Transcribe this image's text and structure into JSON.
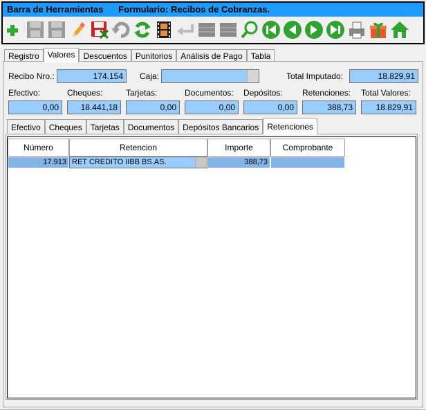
{
  "window": {
    "caption_left": "Barra de Herramientas",
    "caption_right": "Formulario: Recibos de Cobranzas."
  },
  "toolbar": {
    "buttons": [
      {
        "name": "add-icon",
        "color": "#33aa33"
      },
      {
        "name": "save-icon",
        "color": "#909090"
      },
      {
        "name": "save-as-icon",
        "color": "#909090"
      },
      {
        "name": "edit-pencil-icon",
        "color": "#e07020"
      },
      {
        "name": "cancel-save-icon",
        "color": "#cc2222"
      },
      {
        "name": "undo-icon",
        "color": "#909090"
      },
      {
        "name": "refresh-icon",
        "color": "#33aa33"
      },
      {
        "name": "film-icon",
        "color": "#b06010"
      },
      {
        "name": "back-arrow-icon",
        "color": "#c0c0c0"
      },
      {
        "name": "grid-icon",
        "color": "#909090"
      },
      {
        "name": "grid2-icon",
        "color": "#909090"
      },
      {
        "name": "search-icon",
        "color": "#339933"
      },
      {
        "name": "first-icon",
        "color": "#33aa33"
      },
      {
        "name": "previous-icon",
        "color": "#33aa33"
      },
      {
        "name": "next-icon",
        "color": "#33aa33"
      },
      {
        "name": "last-icon",
        "color": "#33aa33"
      },
      {
        "name": "printer-icon",
        "color": "#606060"
      },
      {
        "name": "gift-icon",
        "color": "#e05020"
      },
      {
        "name": "home-icon",
        "color": "#33aa33"
      }
    ]
  },
  "tabs_main": [
    "Registro",
    "Valores",
    "Descuentos",
    "Punitorios",
    "Análisis de Pago",
    "Tabla"
  ],
  "tabs_main_active": 1,
  "header": {
    "recibo_label": "Recibo Nro.:",
    "recibo_value": "174.154",
    "caja_label": "Caja:",
    "caja_value": "",
    "total_imputado_label": "Total Imputado:",
    "total_imputado_value": "18.829,91"
  },
  "totals": {
    "efectivo_label": "Efectivo:",
    "efectivo_value": "0,00",
    "cheques_label": "Cheques:",
    "cheques_value": "18.441,18",
    "tarjetas_label": "Tarjetas:",
    "tarjetas_value": "0,00",
    "documentos_label": "Documentos:",
    "documentos_value": "0,00",
    "depositos_label": "Depósitos:",
    "depositos_value": "0,00",
    "retenciones_label": "Retenciones:",
    "retenciones_value": "388,73",
    "total_valores_label": "Total Valores:",
    "total_valores_value": "18.829,91"
  },
  "tabs_sub": [
    "Efectivo",
    "Cheques",
    "Tarjetas",
    "Documentos",
    "Depósitos Bancarios",
    "Retenciones"
  ],
  "tabs_sub_active": 5,
  "grid": {
    "headers": [
      "Número",
      "Retencion",
      "Importe",
      "Comprobante"
    ],
    "rows": [
      {
        "numero": "17.913",
        "retencion": "RET CREDITO IIBB BS.AS.",
        "importe": "388,73",
        "comprobante": ""
      }
    ]
  }
}
